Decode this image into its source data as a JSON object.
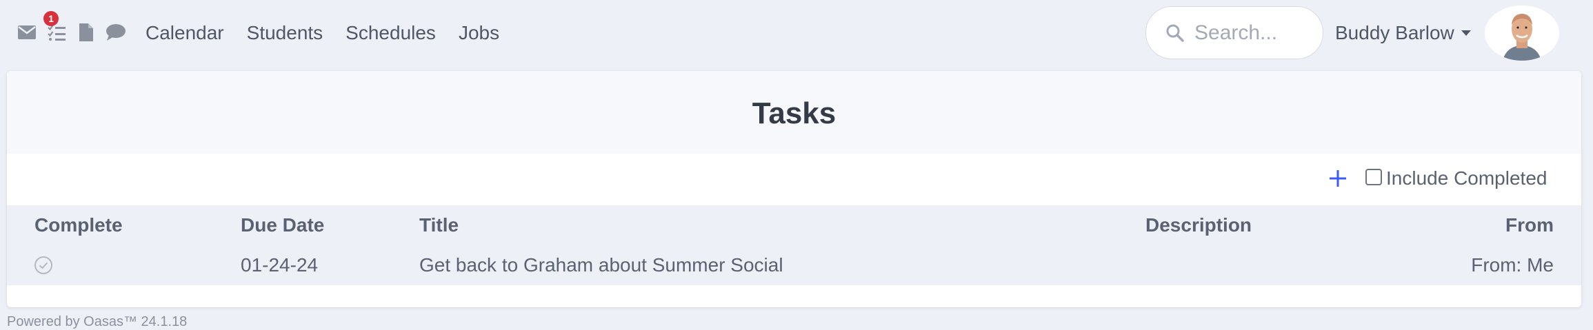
{
  "nav": {
    "icons": [
      "envelope-icon",
      "tasks-icon",
      "file-icon",
      "comment-icon"
    ],
    "tasks_badge": "1",
    "links": [
      "Calendar",
      "Students",
      "Schedules",
      "Jobs"
    ]
  },
  "search": {
    "placeholder": "Search...",
    "value": ""
  },
  "user": {
    "name": "Buddy Barlow"
  },
  "card": {
    "title": "Tasks",
    "include_completed_label": "Include Completed",
    "include_completed_checked": false
  },
  "table": {
    "headers": {
      "complete": "Complete",
      "due_date": "Due Date",
      "title": "Title",
      "description": "Description",
      "from": "From"
    },
    "rows": [
      {
        "complete": false,
        "due_date": "01-24-24",
        "title": "Get back to Graham about Summer Social",
        "description": "",
        "from": "From: Me"
      }
    ]
  },
  "footer": {
    "text": "Powered by Oasas™ 24.1.18"
  },
  "colors": {
    "page_bg": "#eef0f7",
    "accent": "#3d5afe",
    "badge": "#d9303e",
    "title_text": "#343a46"
  }
}
